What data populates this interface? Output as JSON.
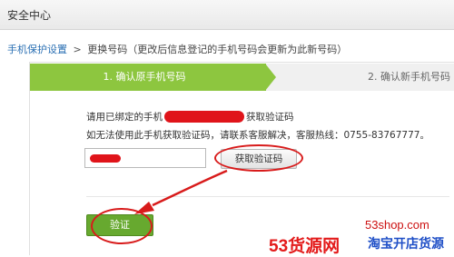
{
  "header": {
    "title": "安全中心"
  },
  "breadcrumb": {
    "link": "手机保护设置",
    "separator": ">",
    "current": "更换号码（更改后信息登记的手机号码会更新为此新号码）"
  },
  "steps": [
    {
      "label": "1. 确认原手机号码",
      "active": true
    },
    {
      "label": "2. 确认新手机号码",
      "active": false
    }
  ],
  "verify_form": {
    "line1_prefix": "请用已绑定的手机",
    "line1_suffix": "获取验证码",
    "line2": "如无法使用此手机获取验证码，请联系客服解决，客服热线：0755-83767777。",
    "get_code_button": "获取验证码",
    "submit_button": "验证"
  },
  "watermark": {
    "site": "53shop.com",
    "brand": "53货源网",
    "slogan": "淘宝开店货源"
  },
  "colors": {
    "step_active": "#8dc63f",
    "submit_button": "#67a92f",
    "annotation": "#d81b1b",
    "link": "#2a6fb3"
  }
}
